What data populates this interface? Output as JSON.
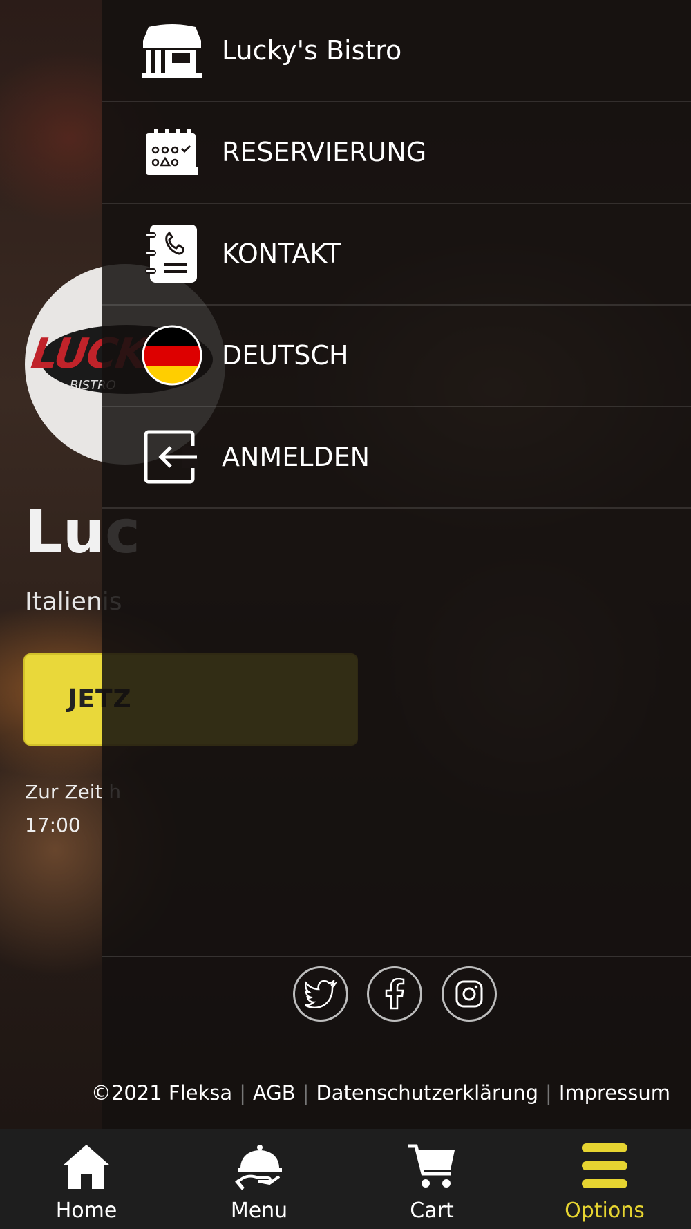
{
  "background_page": {
    "logo": {
      "word": "LUCKY",
      "sub": "BISTRO"
    },
    "title_partial": "Luc",
    "subtitle_partial": "Italienis",
    "cta_partial": "JETZ",
    "hours_line1_partial": "Zur Zeit h",
    "hours_line2": "17:00"
  },
  "drawer": {
    "items": [
      {
        "label": "Lucky's Bistro",
        "icon": "store-icon"
      },
      {
        "label": "RESERVIERUNG",
        "icon": "calendar-icon"
      },
      {
        "label": "KONTAKT",
        "icon": "contact-book-icon"
      },
      {
        "label": "DEUTSCH",
        "icon": "german-flag-icon"
      },
      {
        "label": "ANMELDEN",
        "icon": "login-icon"
      }
    ],
    "social": [
      "twitter-icon",
      "facebook-icon",
      "instagram-icon"
    ],
    "footer": {
      "copyright": "©2021 Fleksa",
      "agb": "AGB",
      "privacy": "Datenschutzerklärung",
      "imprint": "Impressum"
    }
  },
  "bottom_nav": {
    "items": [
      {
        "label": "Home",
        "icon": "home-icon",
        "active": false
      },
      {
        "label": "Menu",
        "icon": "cloche-icon",
        "active": false
      },
      {
        "label": "Cart",
        "icon": "cart-icon",
        "active": false
      },
      {
        "label": "Options",
        "icon": "hamburger-icon",
        "active": true
      }
    ]
  },
  "colors": {
    "accent": "#e6d431",
    "drawer_bg": "#14100f",
    "nav_bg": "#1e1e1e"
  }
}
